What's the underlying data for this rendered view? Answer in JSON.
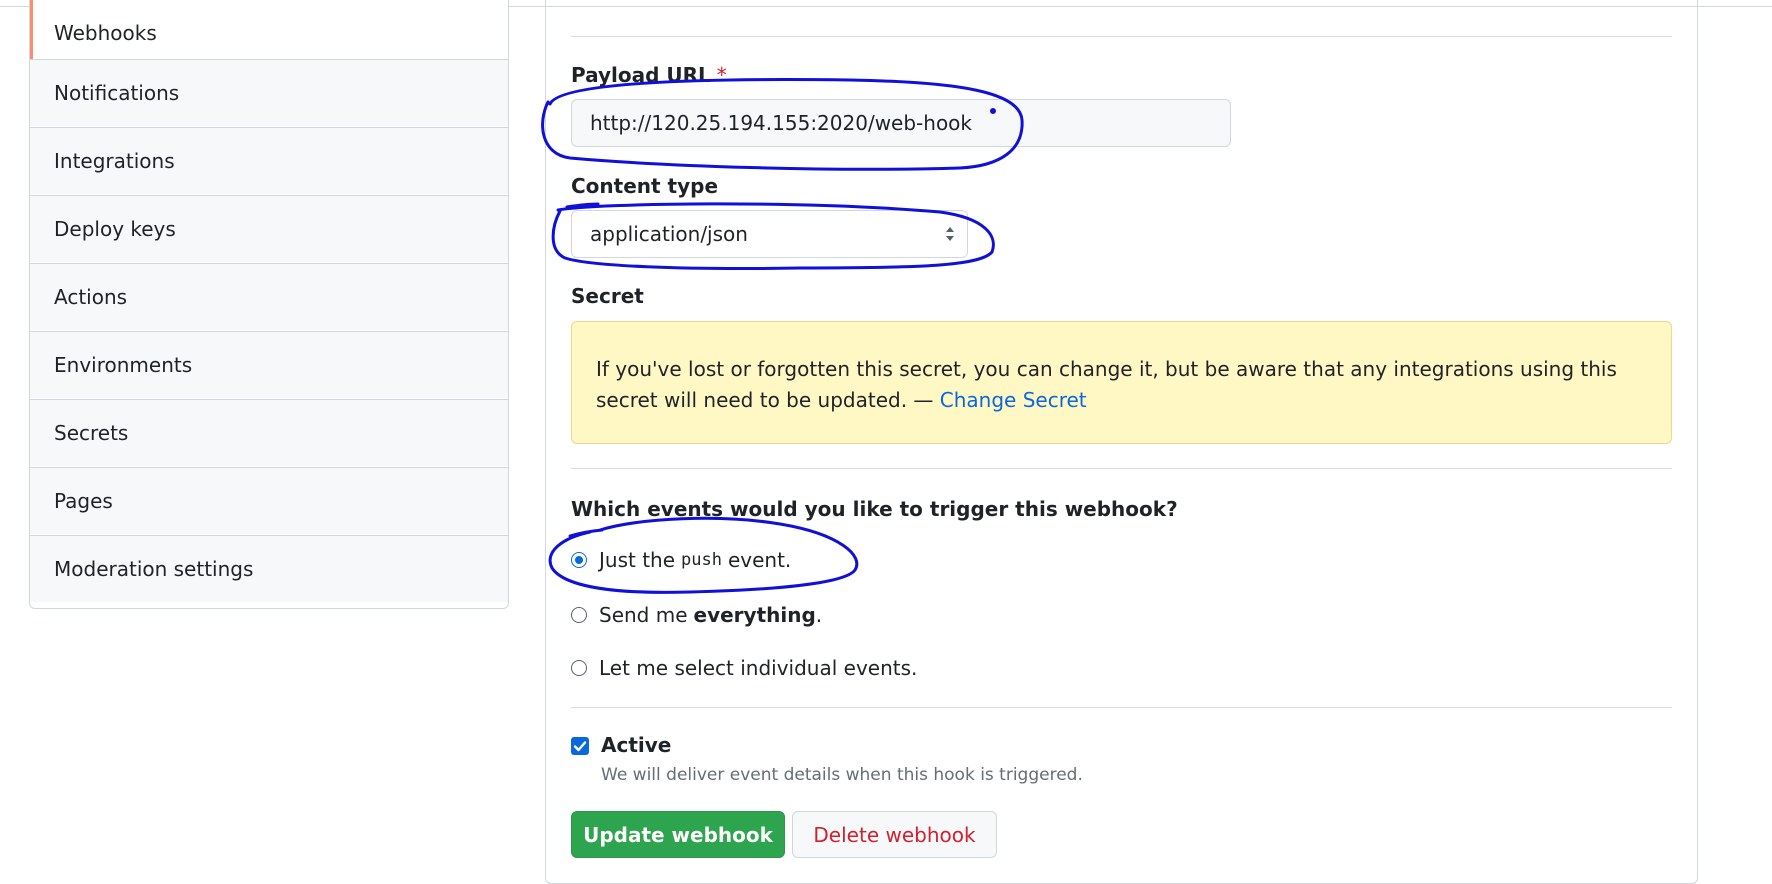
{
  "sidebar": {
    "items": [
      {
        "label": "Webhooks",
        "active": true
      },
      {
        "label": "Notifications"
      },
      {
        "label": "Integrations"
      },
      {
        "label": "Deploy keys"
      },
      {
        "label": "Actions"
      },
      {
        "label": "Environments"
      },
      {
        "label": "Secrets"
      },
      {
        "label": "Pages"
      },
      {
        "label": "Moderation settings"
      }
    ]
  },
  "form": {
    "payload_url": {
      "label": "Payload URL",
      "required_mark": "*",
      "value": "http://120.25.194.155:2020/web-hook"
    },
    "content_type": {
      "label": "Content type",
      "selected": "application/json"
    },
    "secret": {
      "label": "Secret",
      "notice_text": "If you've lost or forgotten this secret, you can change it, but be aware that any integrations using this secret will need to be updated. — ",
      "change_link": "Change Secret"
    },
    "events": {
      "question": "Which events would you like to trigger this webhook?",
      "options": [
        {
          "pre": "Just the",
          "code": "push",
          "post": "event.",
          "checked": true
        },
        {
          "pre": "Send me",
          "bold": "everything",
          "post": ".",
          "checked": false
        },
        {
          "text": "Let me select individual events.",
          "checked": false
        }
      ]
    },
    "active": {
      "label": "Active",
      "checked": true,
      "hint": "We will deliver event details when this hook is triggered."
    },
    "buttons": {
      "update": "Update webhook",
      "delete": "Delete webhook"
    }
  },
  "colors": {
    "annotation": "#1010d8",
    "primary": "#2da44e",
    "danger": "#cf222e",
    "link": "#0969da",
    "active_marker": "#fd8c73"
  }
}
